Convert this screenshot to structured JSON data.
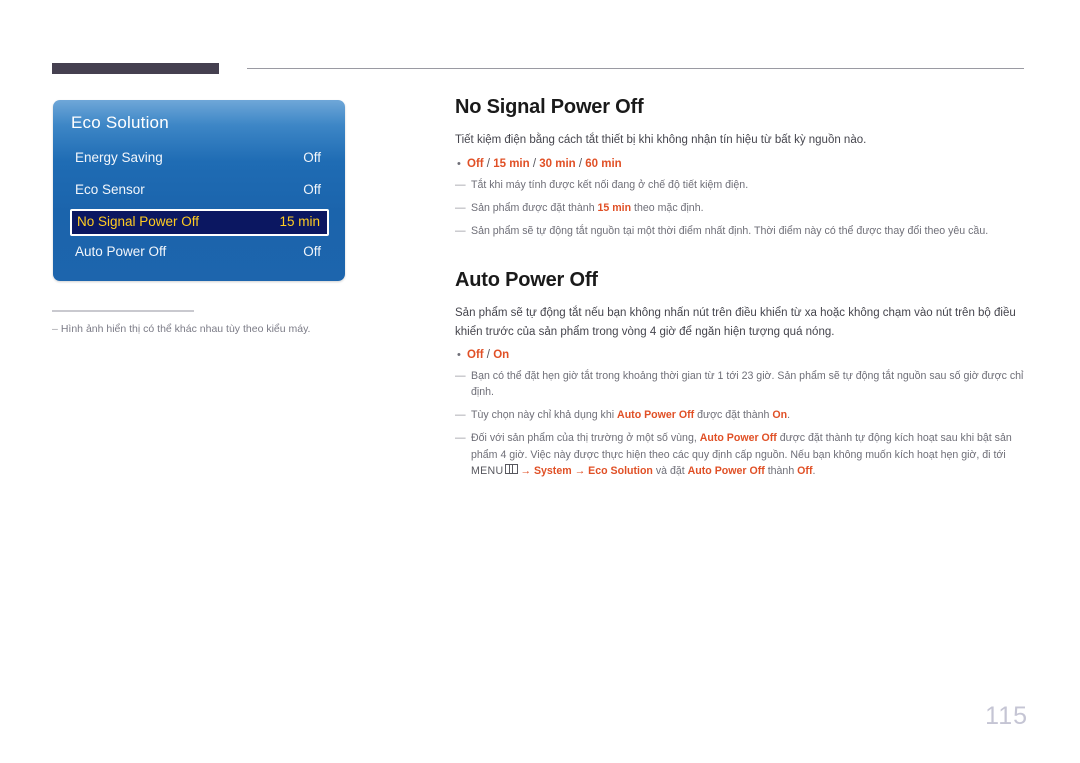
{
  "header": {
    "tab_block": "",
    "rule": ""
  },
  "osd": {
    "title": "Eco Solution",
    "rows": [
      {
        "label": "Energy Saving",
        "value": "Off",
        "selected": false
      },
      {
        "label": "Eco Sensor",
        "value": "Off",
        "selected": false
      },
      {
        "label": "No Signal Power Off",
        "value": "15 min",
        "selected": true
      },
      {
        "label": "Auto Power Off",
        "value": "Off",
        "selected": false
      }
    ],
    "colors": {
      "panel_top": "#6fa7d8",
      "panel_bottom": "#1d65ad",
      "selected_bg": "#0b1761",
      "selected_text": "#ffcc22",
      "row_text": "#f2f6fb"
    }
  },
  "left_footnote": {
    "dash": "–",
    "text": "Hình ảnh hiển thị có thể khác nhau tùy theo kiểu máy."
  },
  "sections": [
    {
      "heading": "No Signal Power Off",
      "intro": "Tiết kiệm điện bằng cách tắt thiết bị khi không nhận tín hiệu từ bất kỳ nguồn nào.",
      "bullet": {
        "dot": "•",
        "opt1": "Off",
        "sep1": " / ",
        "opt2": "15 min",
        "sep2": " / ",
        "opt3": "30 min",
        "sep3": " / ",
        "opt4": "60 min"
      },
      "notes": [
        {
          "dash": "―",
          "text": "Tắt khi máy tính được kết nối đang ở chế độ tiết kiệm điện."
        },
        {
          "dash": "―",
          "pre": "Sản phẩm được đặt thành ",
          "hl": "15 min",
          "post": " theo mặc định."
        },
        {
          "dash": "―",
          "text": "Sản phẩm sẽ tự động tắt nguồn tại một thời điểm nhất định. Thời điểm này có thể được thay đổi theo yêu cầu."
        }
      ]
    },
    {
      "heading": "Auto Power Off",
      "intro": "Sản phẩm sẽ tự động tắt nếu bạn không nhấn nút trên điều khiển từ xa hoặc không chạm vào nút trên bộ điều khiển trước của sản phẩm trong vòng 4 giờ để ngăn hiện tượng quá nóng.",
      "bullet": {
        "dot": "•",
        "opt1": "Off",
        "sep1": " / ",
        "opt2": "On"
      },
      "notes": [
        {
          "dash": "―",
          "text": "Bạn có thể đặt hẹn giờ tắt trong khoảng thời gian từ 1 tới 23 giờ. Sản phẩm sẽ tự động tắt nguồn sau số giờ được chỉ định."
        },
        {
          "dash": "―",
          "pre": "Tùy chọn này chỉ khả dụng khi ",
          "hl": "Auto Power Off",
          "mid": " được đặt thành ",
          "hl2": "On",
          "post": "."
        },
        {
          "dash": "―",
          "pre": "Đối với sản phẩm của thị trường ở một số vùng, ",
          "hl": "Auto Power Off",
          "mid": " được đặt thành tự động kích hoạt sau khi bật sản phẩm 4 giờ. Việc này được thực hiện theo các quy định cấp nguồn. Nếu bạn không muốn kích hoạt hẹn giờ, đi tới",
          "path": {
            "menu_word": "MENU",
            "menu_icon": "menu-grid-icon",
            "arrow1": "→",
            "system": "System",
            "arrow2": "→",
            "eco": "Eco Solution",
            "connector": " và đặt ",
            "target": "Auto Power Off",
            "connector2": " thành ",
            "value": "Off",
            "period": "."
          }
        }
      ]
    }
  ],
  "page_number": "115",
  "accent_color": "#e05026"
}
